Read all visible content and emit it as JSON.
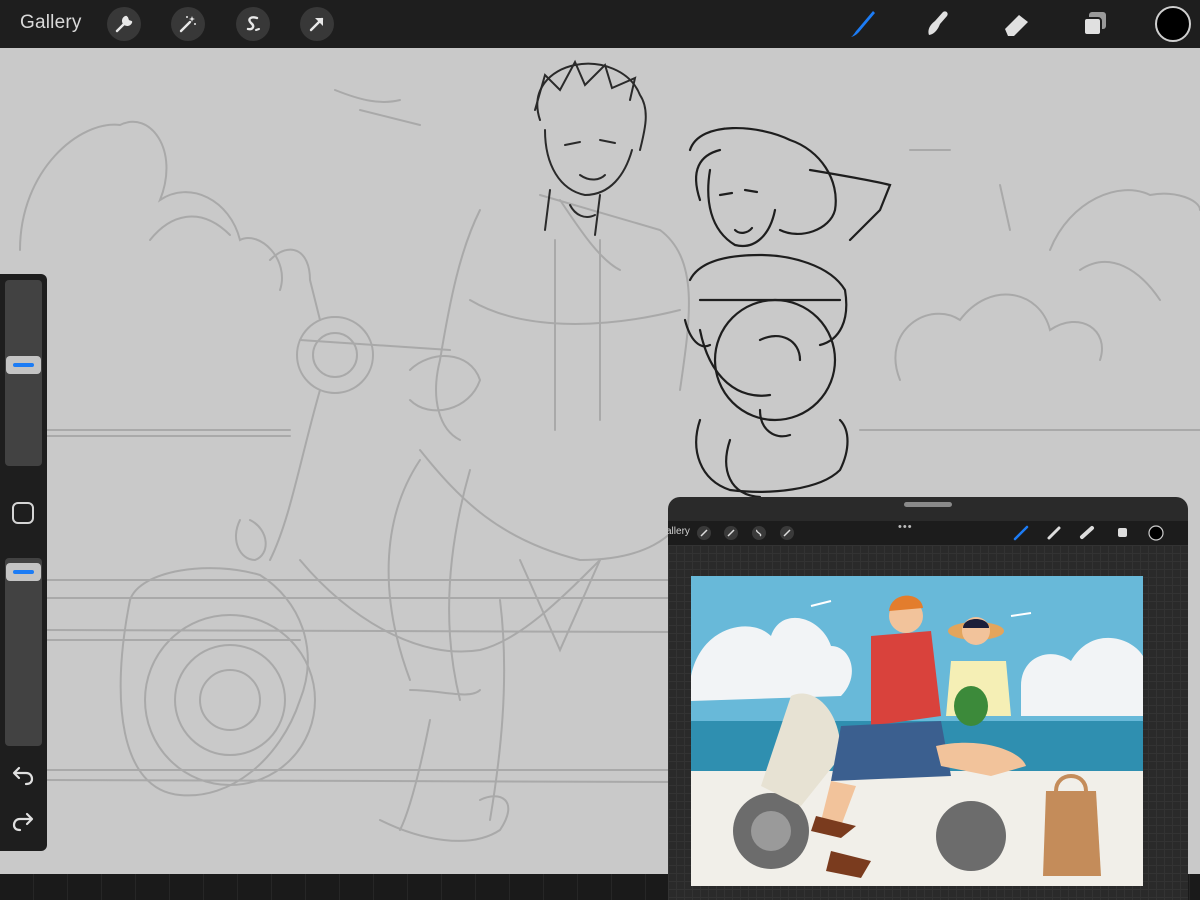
{
  "app": {
    "toolbar": {
      "gallery_label": "Gallery",
      "left_tools": [
        "wrench-icon",
        "magic-wand-icon",
        "selection-s-icon",
        "transform-arrow-icon"
      ],
      "right_tools": [
        "brush-icon",
        "smudge-icon",
        "eraser-icon",
        "layers-icon"
      ],
      "active_tool": "brush",
      "accent_color": "#1c7cf5",
      "current_color": "#000000"
    },
    "sidebar": {
      "brush_size_level": 0.55,
      "opacity_level": 0.98,
      "icons": [
        "modify-square-icon",
        "undo-icon",
        "redo-icon"
      ]
    },
    "reference_window": {
      "gallery_label": "allery",
      "menu_dots": "•••"
    }
  }
}
